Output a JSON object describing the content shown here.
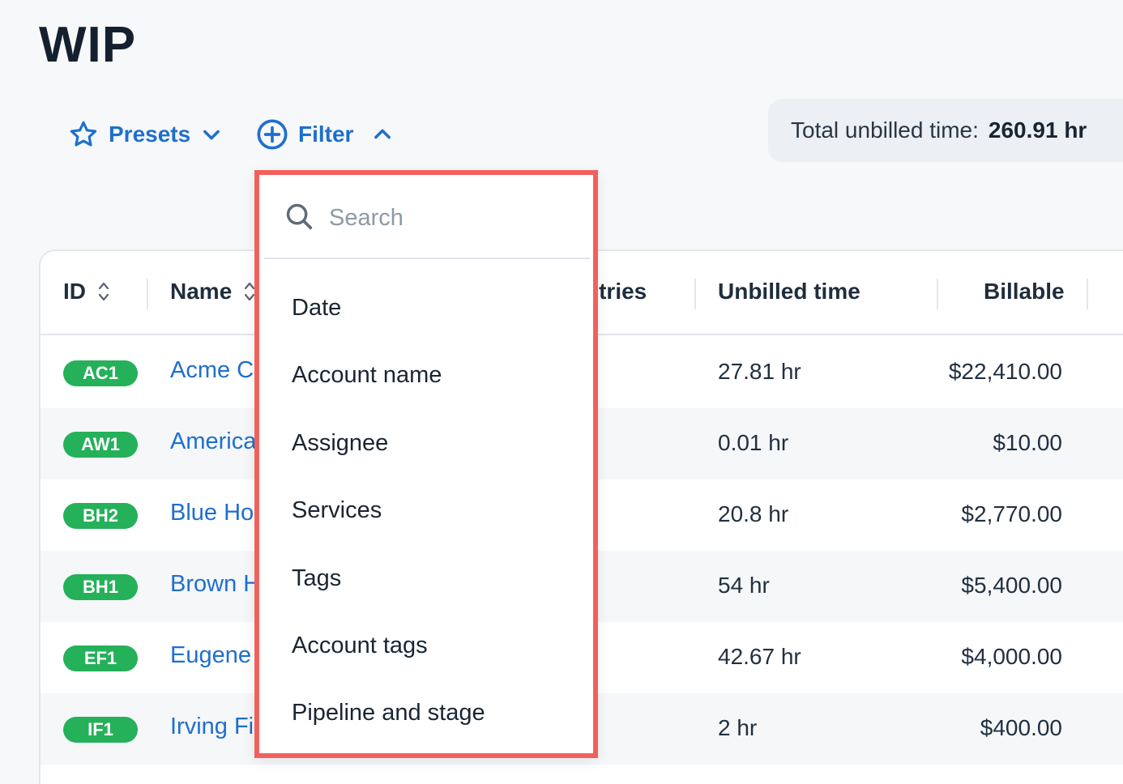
{
  "page": {
    "title": "WIP"
  },
  "toolbar": {
    "presets_label": "Presets",
    "filter_label": "Filter",
    "total_label": "Total unbilled time:",
    "total_value": "260.91 hr"
  },
  "table": {
    "headers": {
      "id": "ID",
      "name": "Name",
      "entries": "ntries",
      "unbilled": "Unbilled time",
      "billable": "Billable"
    },
    "rows": [
      {
        "id": "AC1",
        "name": "Acme Co",
        "unbilled": "27.81 hr",
        "billable": "$22,410.00"
      },
      {
        "id": "AW1",
        "name": "America",
        "unbilled": "0.01 hr",
        "billable": "$10.00"
      },
      {
        "id": "BH2",
        "name": "Blue Hor",
        "unbilled": "20.8 hr",
        "billable": "$2,770.00"
      },
      {
        "id": "BH1",
        "name": "Brown H",
        "unbilled": "54 hr",
        "billable": "$5,400.00"
      },
      {
        "id": "EF1",
        "name": "Eugene I",
        "unbilled": "42.67 hr",
        "billable": "$4,000.00"
      },
      {
        "id": "IF1",
        "name": "Irving Fis",
        "unbilled": "2 hr",
        "billable": "$400.00"
      }
    ]
  },
  "filter_menu": {
    "search_placeholder": "Search",
    "items": [
      "Date",
      "Account name",
      "Assignee",
      "Services",
      "Tags",
      "Account tags",
      "Pipeline and stage"
    ]
  },
  "colors": {
    "accent": "#1e6fce",
    "badge": "#25b05a",
    "highlight_border": "#f2605e"
  },
  "icons": [
    "star-icon",
    "chevron-down-icon",
    "plus-circle-icon",
    "chevron-up-icon",
    "sort-icon",
    "search-icon"
  ]
}
